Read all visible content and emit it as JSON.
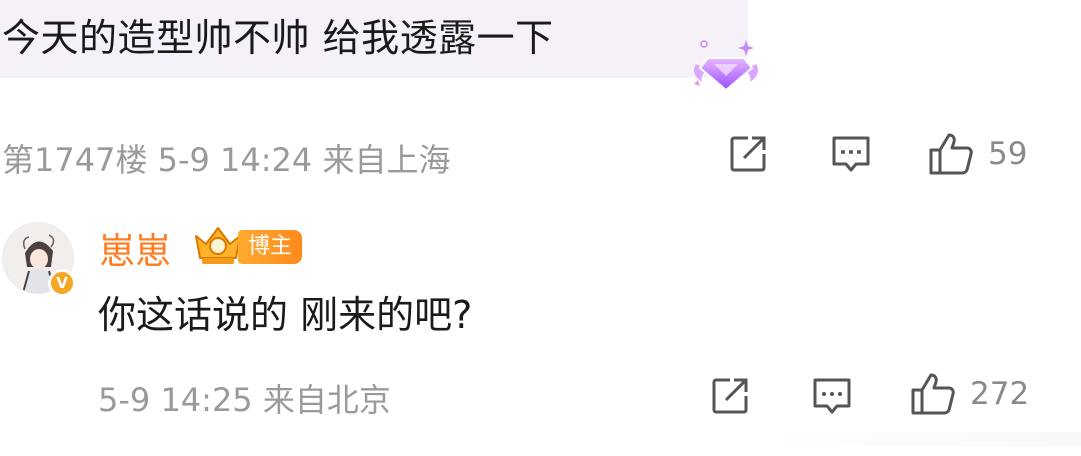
{
  "comment": {
    "text": "今天的造型帅不帅 给我透露一下",
    "meta": "第1747楼 5-9 14:24 来自上海",
    "like_count": "59",
    "badge_icon": "purple-diamond-gem-icon"
  },
  "reply": {
    "author": "崽崽",
    "role_tag": "博主",
    "verified_mark": "V",
    "text": "你这话说的 刚来的吧?",
    "meta": "5-9 14:25 来自北京",
    "like_count": "272"
  },
  "colors": {
    "bubble_bg": "#f6f0f8",
    "author_orange": "#ff7c1f",
    "meta_gray": "#9a9a9a",
    "icon_gray": "#555555"
  }
}
